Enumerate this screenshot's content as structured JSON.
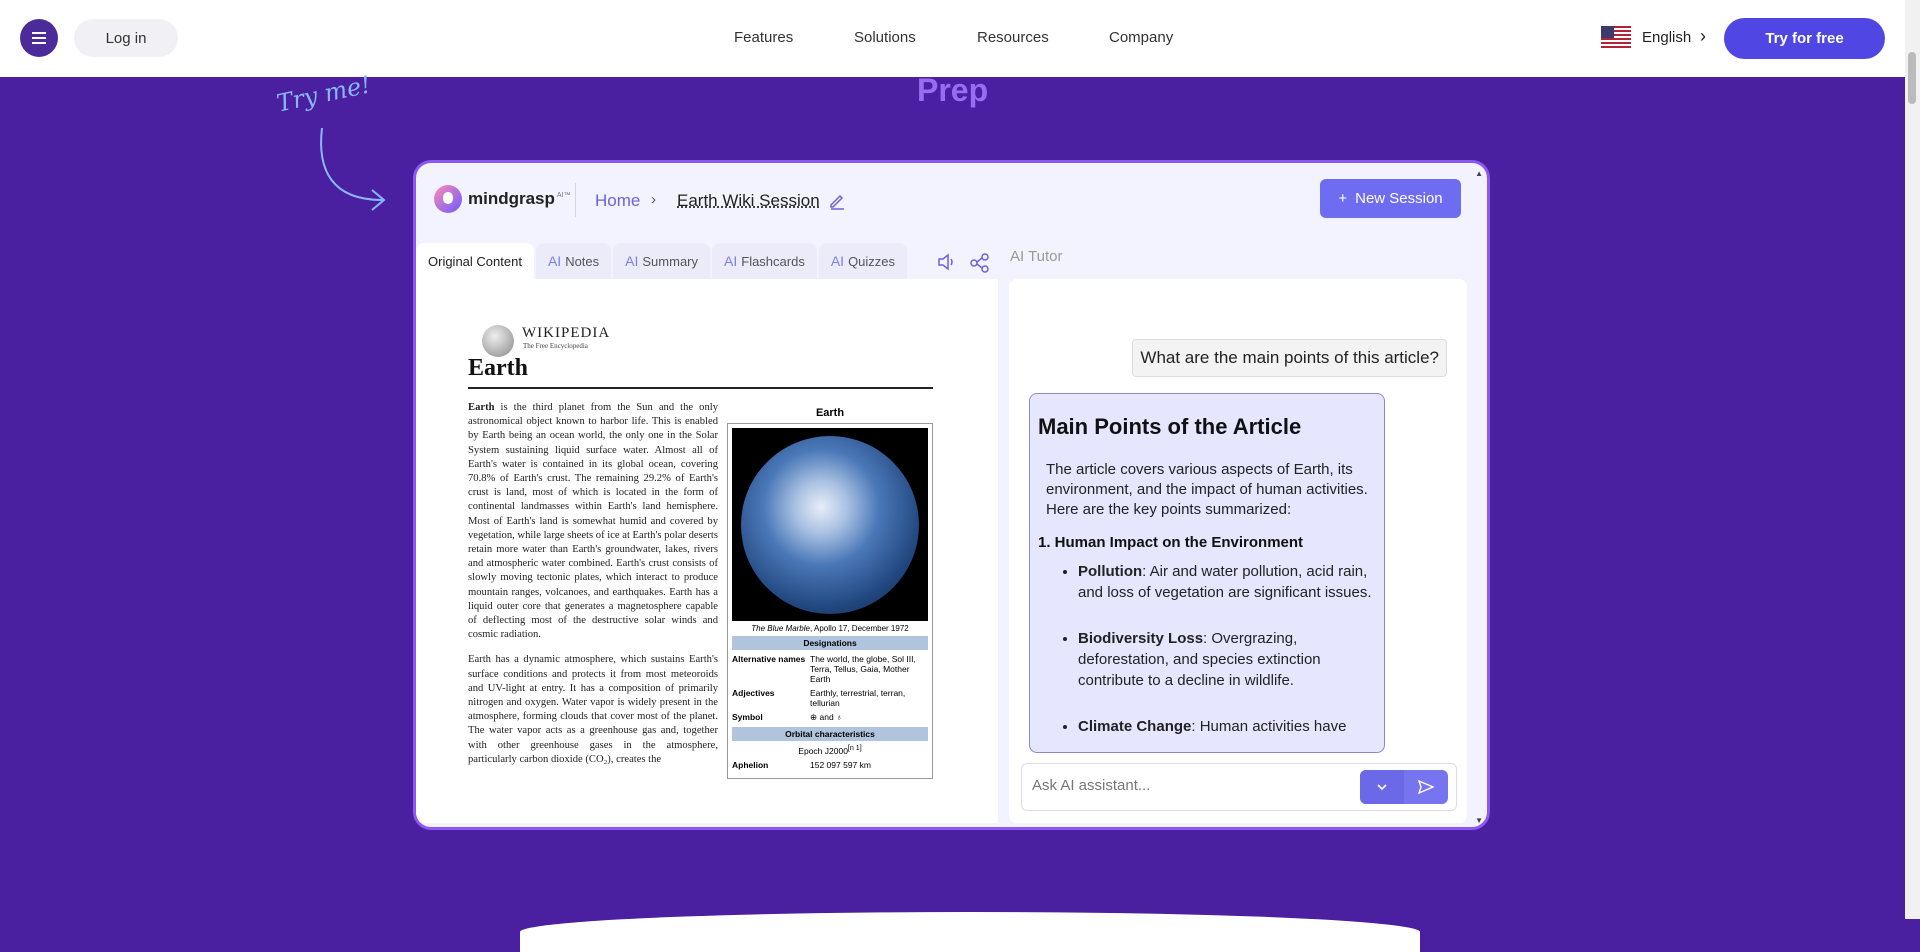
{
  "nav": {
    "login": "Log in",
    "links": [
      "Features",
      "Solutions",
      "Resources",
      "Company"
    ],
    "language": "English",
    "cta": "Try for free"
  },
  "hero": {
    "heading_fragment": "Prep",
    "hint": "Try me!"
  },
  "app": {
    "logo": "mindgrasp",
    "logo_badge": "AI™",
    "breadcrumb_home": "Home",
    "session_title": "Earth Wiki Session",
    "new_session": "New Session",
    "tabs": [
      {
        "prefix": "",
        "label": "Original Content"
      },
      {
        "prefix": "AI",
        "label": "Notes"
      },
      {
        "prefix": "AI",
        "label": "Summary"
      },
      {
        "prefix": "AI",
        "label": "Flashcards"
      },
      {
        "prefix": "AI",
        "label": "Quizzes"
      }
    ],
    "ai_tutor": "AI Tutor"
  },
  "document": {
    "wiki_name": "WIKIPEDIA",
    "wiki_sub": "The Free Encyclopedia",
    "title": "Earth",
    "para1_bold": "Earth",
    "para1": " is the third planet from the Sun and the only astronomical object known to harbor life. This is enabled by Earth being an ocean world, the only one in the Solar System sustaining liquid surface water. Almost all of Earth's water is contained in its global ocean, covering 70.8% of Earth's crust. The remaining 29.2% of Earth's crust is land, most of which is located in the form of continental landmasses within Earth's land hemisphere. Most of Earth's land is somewhat humid and covered by vegetation, while large sheets of ice at Earth's polar deserts retain more water than Earth's groundwater, lakes, rivers and atmospheric water combined. Earth's crust consists of slowly moving tectonic plates, which interact to produce mountain ranges, volcanoes, and earthquakes. Earth has a liquid outer core that generates a magnetosphere capable of deflecting most of the destructive solar winds and cosmic radiation.",
    "para2": "Earth has a dynamic atmosphere, which sustains Earth's surface conditions and protects it from most meteoroids and UV-light at entry. It has a composition of primarily nitrogen and oxygen. Water vapor is widely present in the atmosphere, forming clouds that cover most of the planet. The water vapor acts as a greenhouse gas and, together with other greenhouse gases in the atmosphere, particularly carbon dioxide (CO₂), creates the",
    "infobox": {
      "title": "Earth",
      "caption_italic": "The Blue Marble",
      "caption": ", Apollo 17, December 1972",
      "section1": "Designations",
      "rows": [
        {
          "k": "Alternative names",
          "v": "The world, the globe, Sol III, Terra, Tellus, Gaia, Mother Earth"
        },
        {
          "k": "Adjectives",
          "v": "Earthly, terrestrial, terran, tellurian"
        },
        {
          "k": "Symbol",
          "v": "⊕ and ♁"
        }
      ],
      "section2": "Orbital characteristics",
      "epoch": "Epoch J2000",
      "epoch_note": "[n 1]",
      "aphelion_k": "Aphelion",
      "aphelion_v": "152 097 597 km"
    }
  },
  "chat": {
    "question": "What are the main points of this article?",
    "answer_title": "Main Points of the Article",
    "answer_intro": "The article covers various aspects of Earth, its environment, and the impact of human activities. Here are the key points summarized:",
    "section_heading": "1. Human Impact on the Environment",
    "points": [
      {
        "term": "Pollution",
        "text": ": Air and water pollution, acid rain, and loss of vegetation are significant issues."
      },
      {
        "term": "Biodiversity Loss",
        "text": ": Overgrazing, deforestation, and species extinction contribute to a decline in wildlife."
      },
      {
        "term": "Climate Change",
        "text": ": Human activities have"
      }
    ],
    "input_placeholder": "Ask AI assistant..."
  },
  "colors": {
    "background": "#4a1fa0",
    "accent": "#5046e4",
    "frame_border": "#8b58f0",
    "prep": "#9a6cf2"
  }
}
